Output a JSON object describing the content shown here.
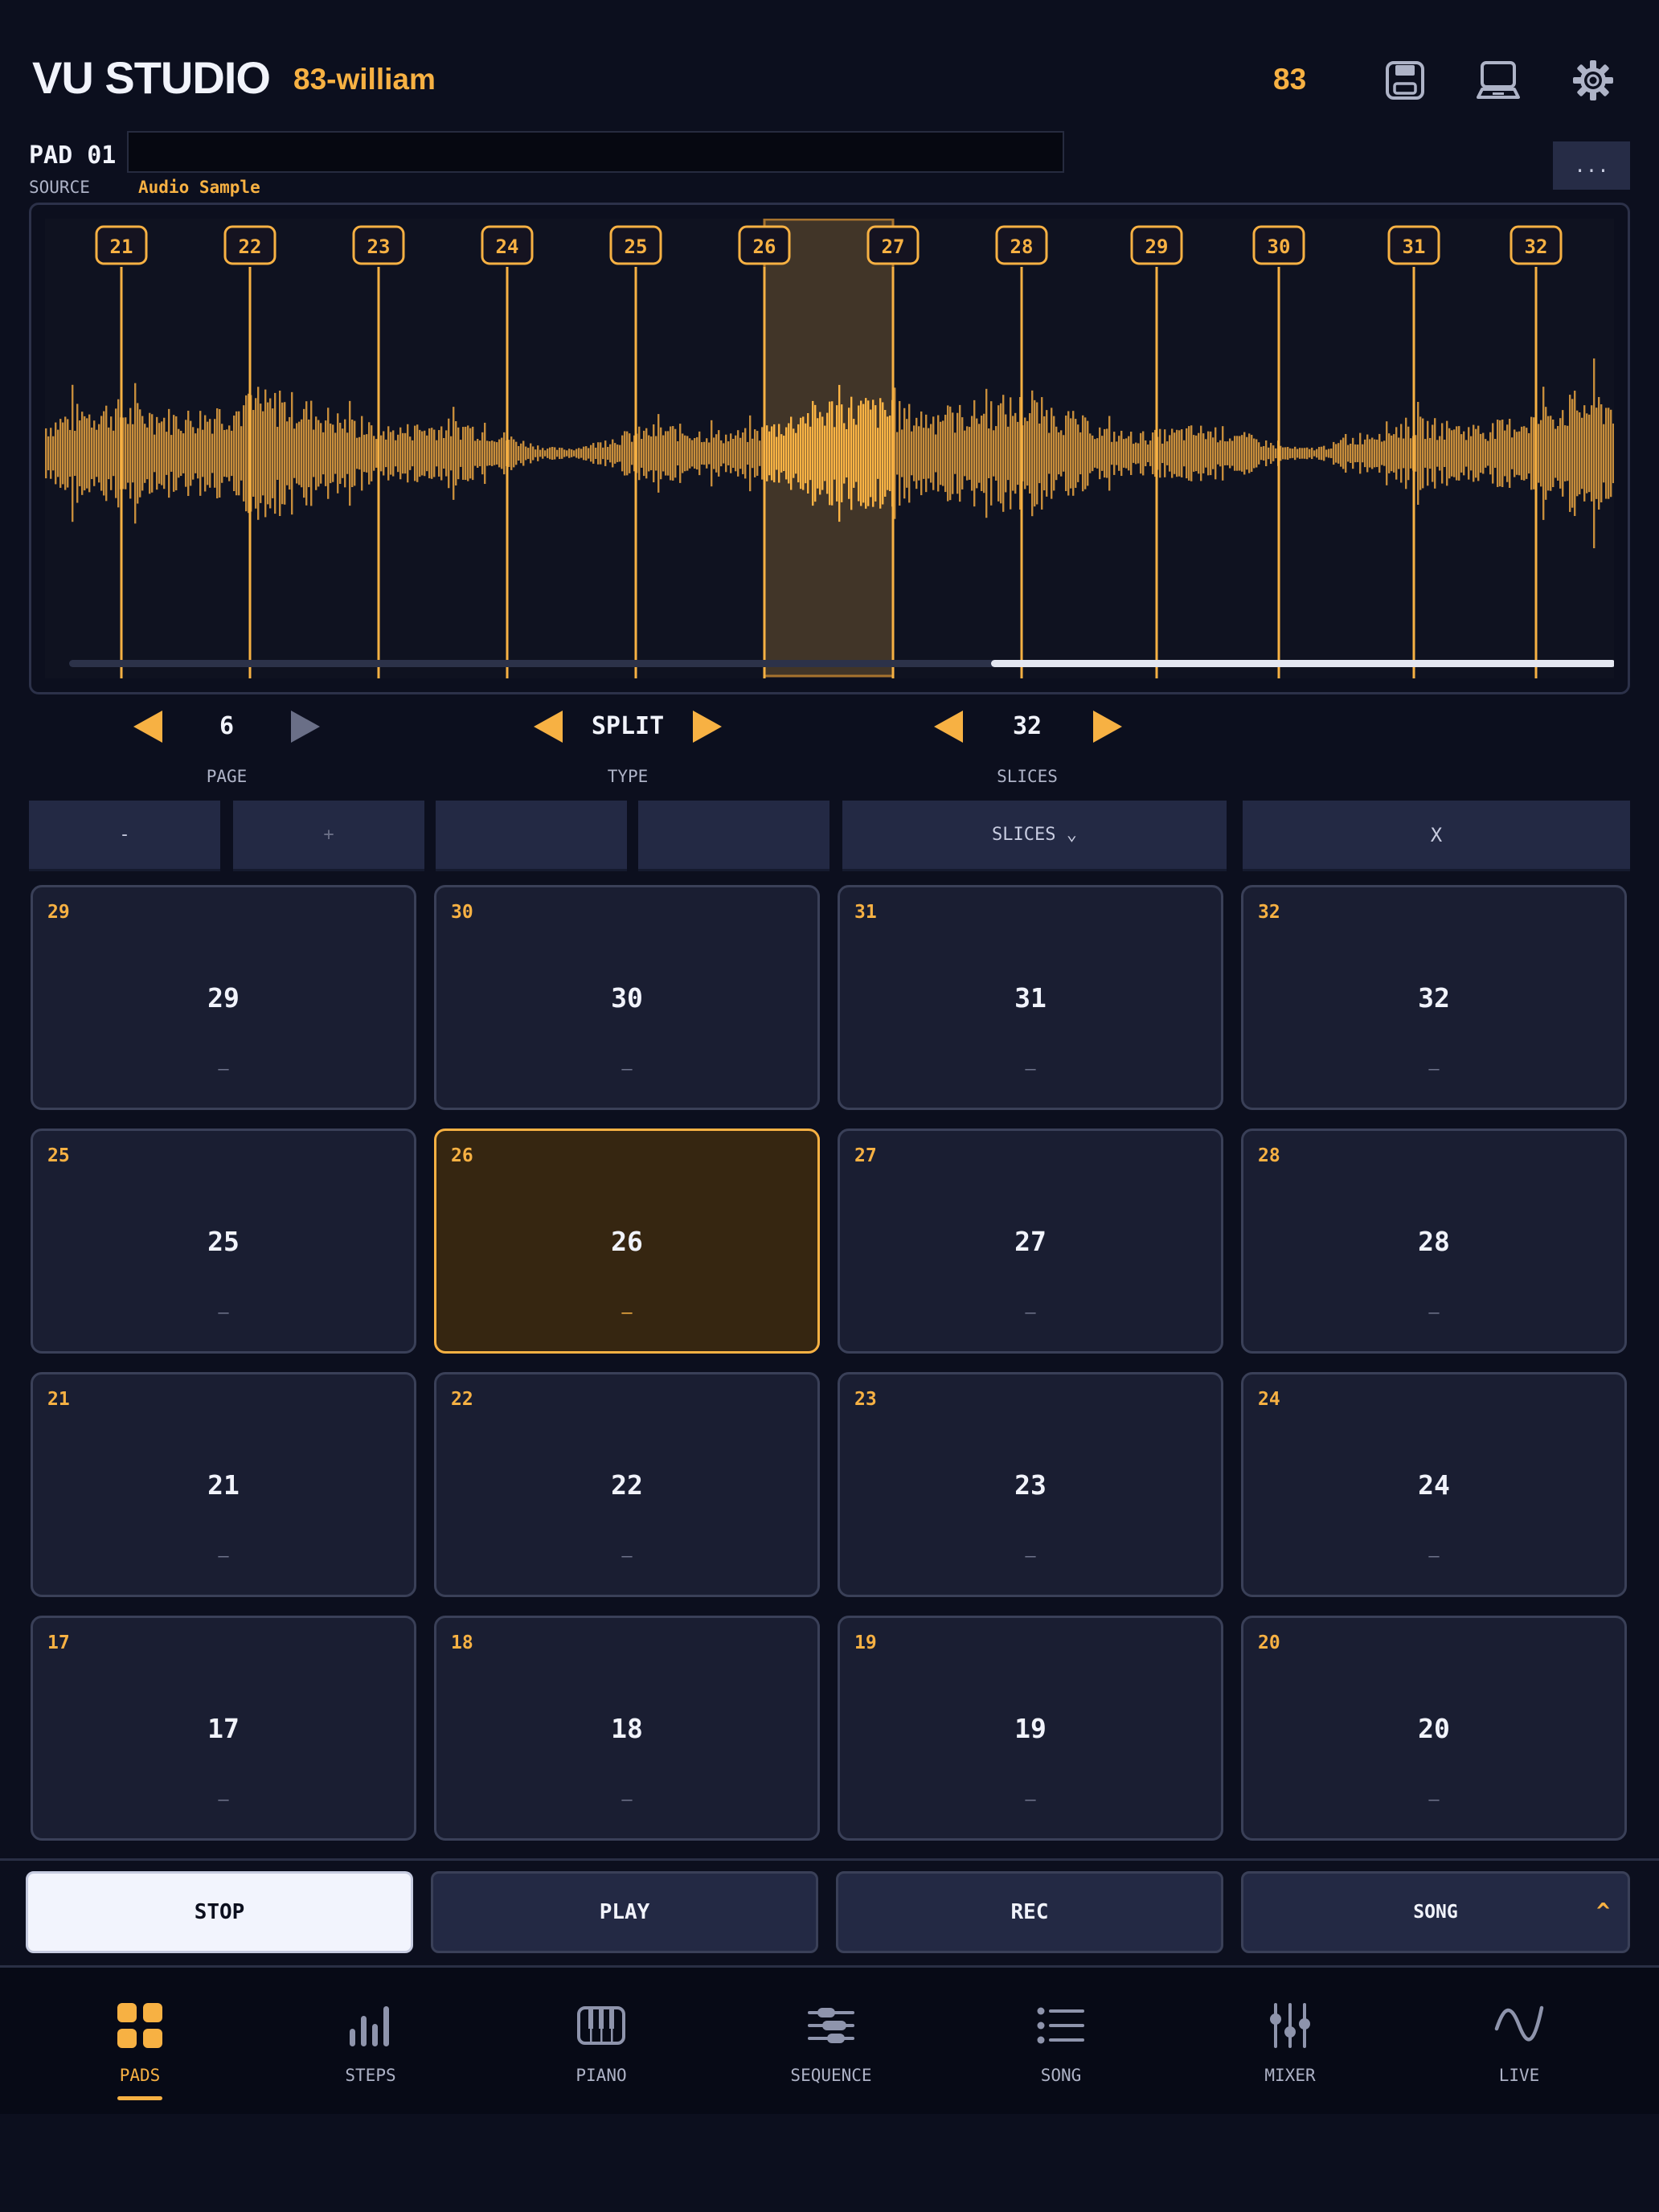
{
  "header": {
    "app_title": "VU STUDIO",
    "project_name": "83-william",
    "bpm": "83",
    "icons": [
      "save-icon",
      "computer-icon",
      "gear-icon"
    ]
  },
  "pad_info": {
    "pad_label": "PAD 01",
    "name_value": "",
    "source_label": "SOURCE",
    "source_value": "Audio Sample",
    "more_label": "..."
  },
  "waveform": {
    "slice_markers": [
      "21",
      "22",
      "23",
      "24",
      "25",
      "26",
      "27",
      "28",
      "29",
      "30",
      "31",
      "32"
    ],
    "selected_marker": "26",
    "scroll_position": 0.62
  },
  "controls": {
    "page": {
      "value": "6",
      "label": "PAGE"
    },
    "type": {
      "value": "SPLIT",
      "label": "TYPE"
    },
    "slices": {
      "value": "32",
      "label": "SLICES"
    }
  },
  "tools": {
    "minus": "-",
    "plus": "+",
    "blank_1": "",
    "blank_2": "",
    "slices_dropdown": "SLICES ⌄",
    "clear": "X"
  },
  "pads": [
    {
      "num": "29",
      "label": "29",
      "sub": "–"
    },
    {
      "num": "30",
      "label": "30",
      "sub": "–"
    },
    {
      "num": "31",
      "label": "31",
      "sub": "–"
    },
    {
      "num": "32",
      "label": "32",
      "sub": "–"
    },
    {
      "num": "25",
      "label": "25",
      "sub": "–"
    },
    {
      "num": "26",
      "label": "26",
      "sub": "–",
      "selected": true
    },
    {
      "num": "27",
      "label": "27",
      "sub": "–"
    },
    {
      "num": "28",
      "label": "28",
      "sub": "–"
    },
    {
      "num": "21",
      "label": "21",
      "sub": "–"
    },
    {
      "num": "22",
      "label": "22",
      "sub": "–"
    },
    {
      "num": "23",
      "label": "23",
      "sub": "–"
    },
    {
      "num": "24",
      "label": "24",
      "sub": "–"
    },
    {
      "num": "17",
      "label": "17",
      "sub": "–"
    },
    {
      "num": "18",
      "label": "18",
      "sub": "–"
    },
    {
      "num": "19",
      "label": "19",
      "sub": "–"
    },
    {
      "num": "20",
      "label": "20",
      "sub": "–"
    }
  ],
  "transport": {
    "stop": "STOP",
    "play": "PLAY",
    "rec": "REC",
    "song": "SONG",
    "song_caret": "^"
  },
  "nav": {
    "active": "PADS",
    "items": [
      {
        "label": "PADS",
        "icon": "pads-grid-icon"
      },
      {
        "label": "STEPS",
        "icon": "steps-bars-icon"
      },
      {
        "label": "PIANO",
        "icon": "piano-icon"
      },
      {
        "label": "SEQUENCE",
        "icon": "sequence-sliders-icon"
      },
      {
        "label": "SONG",
        "icon": "song-list-icon"
      },
      {
        "label": "MIXER",
        "icon": "mixer-faders-icon"
      },
      {
        "label": "LIVE",
        "icon": "live-wave-icon"
      }
    ]
  },
  "colors": {
    "accent": "#f7b143",
    "background": "#0c0f1e",
    "panel": "#1a1e32",
    "button": "#232944"
  }
}
